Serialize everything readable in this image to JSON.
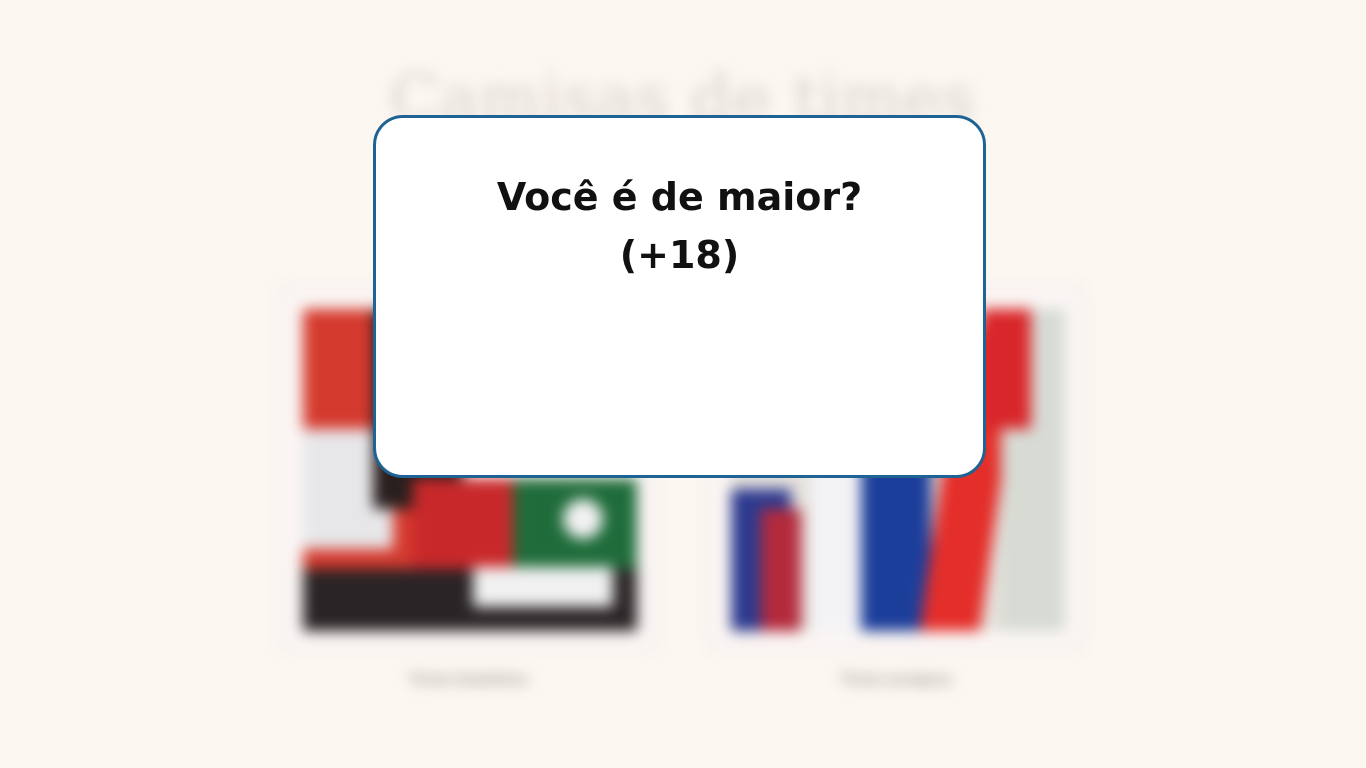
{
  "background": {
    "title": "Camisas de times",
    "cards": [
      {
        "caption": "Times brasileiros"
      },
      {
        "caption": "Times europeus"
      }
    ]
  },
  "modal": {
    "question": "Você é de maior?",
    "subtitle": "(+18)",
    "border_color": "#1f6394"
  }
}
